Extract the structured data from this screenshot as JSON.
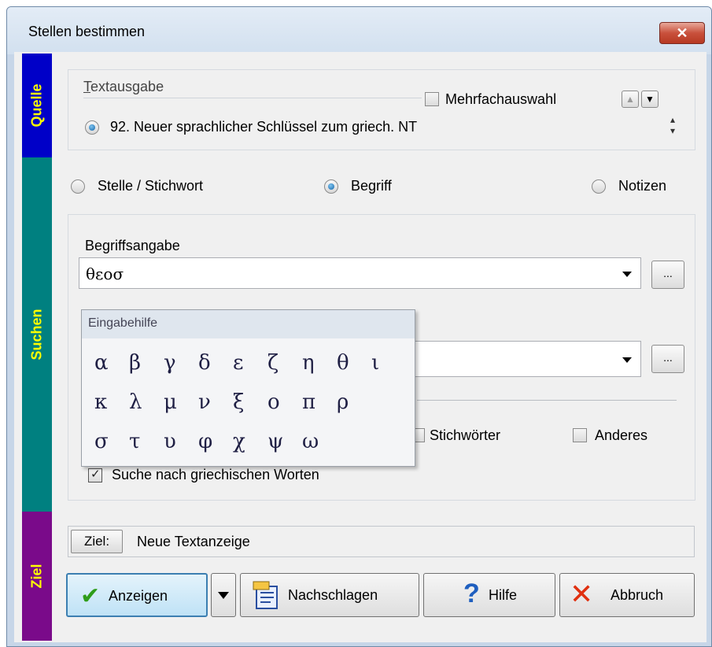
{
  "window": {
    "title": "Stellen bestimmen",
    "close_glyph": "✕"
  },
  "sidebars": {
    "quelle": "Quelle",
    "suchen": "Suchen",
    "ziel": "Ziel"
  },
  "quelle": {
    "group_label": "Textausgabe",
    "multi_label": "Mehrfachauswahl",
    "multi_checked": false,
    "source_text": "92. Neuer sprachlicher Schlüssel zum griech. NT"
  },
  "search_mode": {
    "options": [
      "Stelle / Stichwort",
      "Begriff",
      "Notizen"
    ],
    "selected": "Begriff"
  },
  "begriff": {
    "label": "Begriffsangabe",
    "value": "θεοσ",
    "ellipsis": "..."
  },
  "second_combo": {
    "value": "",
    "ellipsis": "..."
  },
  "popup": {
    "title": "Eingabehilfe",
    "rows": [
      [
        "α",
        "β",
        "γ",
        "δ",
        "ε",
        "ζ",
        "η",
        "θ",
        "ι"
      ],
      [
        "κ",
        "λ",
        "μ",
        "ν",
        "ξ",
        "ο",
        "π",
        "ρ"
      ],
      [
        "σ",
        "τ",
        "υ",
        "φ",
        "χ",
        "ψ",
        "ω"
      ]
    ]
  },
  "options": {
    "stichwoerter": "Stichwörter",
    "anderes": "Anderes",
    "greek_words": "Suche nach griechischen Worten",
    "greek_words_checked": true
  },
  "ziel": {
    "button": "Ziel:",
    "value": "Neue Textanzeige"
  },
  "buttons": {
    "anzeigen": "Anzeigen",
    "nachschlagen": "Nachschlagen",
    "hilfe": "Hilfe",
    "abbruch": "Abbruch"
  },
  "colors": {
    "quelle_bar": "#0000c8",
    "suchen_bar": "#008080",
    "ziel_bar": "#7a0a8a",
    "sidebar_text": "#ffff00",
    "close_button": "#c9513c"
  }
}
